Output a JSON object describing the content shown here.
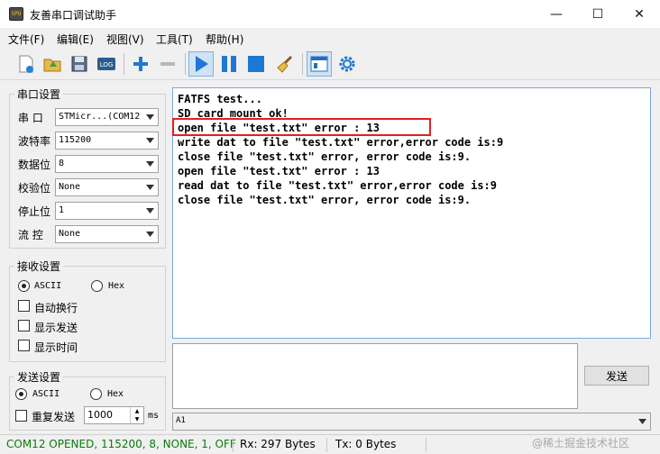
{
  "window": {
    "title": "友善串口调试助手",
    "icon_text": "SPU",
    "minimize_glyph": "—",
    "maximize_glyph": "☐",
    "close_glyph": "✕"
  },
  "menu": [
    "文件(F)",
    "编辑(E)",
    "视图(V)",
    "工具(T)",
    "帮助(H)"
  ],
  "toolbar": {
    "icons": [
      "new-icon",
      "open-icon",
      "save-icon",
      "log-icon",
      "add-icon",
      "remove-icon",
      "play-icon",
      "pause-icon",
      "stop-icon",
      "clear-icon",
      "layout-icon",
      "settings-icon"
    ],
    "log_label": "LOG"
  },
  "serial_settings": {
    "title": "串口设置",
    "fields": [
      {
        "label": "串  口",
        "value": "STMicr...(COM12"
      },
      {
        "label": "波特率",
        "value": "115200"
      },
      {
        "label": "数据位",
        "value": "8"
      },
      {
        "label": "校验位",
        "value": "None"
      },
      {
        "label": "停止位",
        "value": "1"
      },
      {
        "label": "流  控",
        "value": "None"
      }
    ]
  },
  "receive_settings": {
    "title": "接收设置",
    "mode_ascii": "ASCII",
    "mode_hex": "Hex",
    "selected_mode": "ASCII",
    "options": [
      "自动换行",
      "显示发送",
      "显示时间"
    ]
  },
  "send_settings": {
    "title": "发送设置",
    "mode_ascii": "ASCII",
    "mode_hex": "Hex",
    "selected_mode": "ASCII",
    "repeat_label": "重复发送",
    "interval_value": "1000",
    "interval_unit": "ms"
  },
  "receive_text": "FATFS test...\nSD card mount ok!\nopen file \"test.txt\" error : 13\nwrite dat to file \"test.txt\" error,error code is:9\nclose file \"test.txt\" error, error code is:9.\nopen file \"test.txt\" error : 13\nread dat to file \"test.txt\" error,error code is:9\nclose file \"test.txt\" error, error code is:9.",
  "send": {
    "button_label": "发送",
    "history_value": "A1"
  },
  "status": {
    "port": "COM12 OPENED, 115200, 8, NONE, 1, OFF",
    "rx": "Rx: 297 Bytes",
    "tx": "Tx: 0 Bytes",
    "port_color": "#0a7a0a"
  },
  "watermark": "@稀土掘金技术社区",
  "colors": {
    "highlight": "#e02020",
    "toolbar_blue": "#1e78d2"
  }
}
